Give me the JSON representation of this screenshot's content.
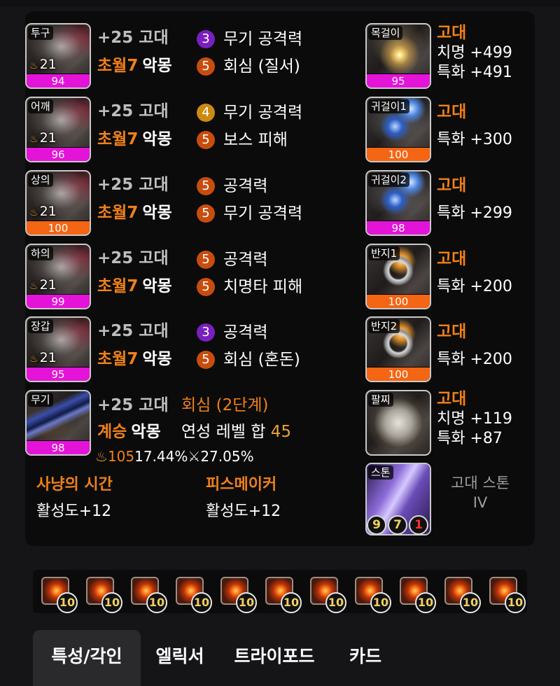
{
  "armor": [
    {
      "slot": "투구",
      "level": "21",
      "quality": "94",
      "enhance": "+25",
      "grade": "고대",
      "set_name": "초월7",
      "set_type": "악몽",
      "effects": [
        {
          "lvl": "3",
          "name": "무기 공격력",
          "color": "purple"
        },
        {
          "lvl": "5",
          "name": "회심 (질서)",
          "color": "orange"
        }
      ]
    },
    {
      "slot": "어깨",
      "level": "21",
      "quality": "96",
      "enhance": "+25",
      "grade": "고대",
      "set_name": "초월7",
      "set_type": "악몽",
      "effects": [
        {
          "lvl": "4",
          "name": "무기 공격력",
          "color": "gold"
        },
        {
          "lvl": "5",
          "name": "보스 피해",
          "color": "orange"
        }
      ]
    },
    {
      "slot": "상의",
      "level": "21",
      "quality": "100",
      "enhance": "+25",
      "grade": "고대",
      "set_name": "초월7",
      "set_type": "악몽",
      "effects": [
        {
          "lvl": "5",
          "name": "공격력",
          "color": "orange"
        },
        {
          "lvl": "5",
          "name": "무기 공격력",
          "color": "orange"
        }
      ]
    },
    {
      "slot": "하의",
      "level": "21",
      "quality": "99",
      "enhance": "+25",
      "grade": "고대",
      "set_name": "초월7",
      "set_type": "악몽",
      "effects": [
        {
          "lvl": "5",
          "name": "공격력",
          "color": "orange"
        },
        {
          "lvl": "5",
          "name": "치명타 피해",
          "color": "orange"
        }
      ]
    },
    {
      "slot": "장갑",
      "level": "21",
      "quality": "95",
      "enhance": "+25",
      "grade": "고대",
      "set_name": "초월7",
      "set_type": "악몽",
      "effects": [
        {
          "lvl": "3",
          "name": "공격력",
          "color": "purple"
        },
        {
          "lvl": "5",
          "name": "회심 (혼돈)",
          "color": "orange"
        }
      ]
    }
  ],
  "weapon": {
    "slot": "무기",
    "quality": "98",
    "enhance": "+25",
    "grade": "고대",
    "elixir_special": "회심 (2단계)",
    "set_name": "계승",
    "set_type": "악몽",
    "elixir_label": "연성 레벨 합",
    "elixir_total": "45",
    "stat_fire": "105",
    "stat_a": "17.44%",
    "stat_b": "27.05%"
  },
  "accessories": [
    {
      "slot": "목걸이",
      "quality": "95",
      "grade": "고대",
      "stats": [
        "치명 +499",
        "특화 +491"
      ],
      "art": "neck"
    },
    {
      "slot": "귀걸이1",
      "quality": "100",
      "grade": "고대",
      "stats": [
        "특화 +300"
      ],
      "art": "ear"
    },
    {
      "slot": "귀걸이2",
      "quality": "98",
      "grade": "고대",
      "stats": [
        "특화 +299"
      ],
      "art": "ear"
    },
    {
      "slot": "반지1",
      "quality": "100",
      "grade": "고대",
      "stats": [
        "특화 +200"
      ],
      "art": "ring"
    },
    {
      "slot": "반지2",
      "quality": "100",
      "grade": "고대",
      "stats": [
        "특화 +200"
      ],
      "art": "ring"
    },
    {
      "slot": "팔찌",
      "grade": "고대",
      "stats": [
        "치명 +119",
        "특화 +87"
      ],
      "art": "brace"
    }
  ],
  "stone": {
    "slot": "스톤",
    "name": "고대 스톤",
    "tier": "IV",
    "engravings": [
      "9",
      "7",
      "1"
    ]
  },
  "elixir_sets": [
    {
      "name": "사냥의 시간",
      "value": "활성도+12"
    },
    {
      "name": "피스메이커",
      "value": "활성도+12"
    }
  ],
  "gems": [
    "10",
    "10",
    "10",
    "10",
    "10",
    "10",
    "10",
    "10",
    "10",
    "10",
    "10"
  ],
  "tabs": [
    {
      "label": "특성/각인",
      "active": true
    },
    {
      "label": "엘릭서",
      "active": false
    },
    {
      "label": "트라이포드",
      "active": false
    },
    {
      "label": "카드",
      "active": false
    }
  ],
  "colors": {
    "quality_pink": "#e413d8",
    "quality_orange": "#f46514",
    "accent": "#f0801a"
  }
}
